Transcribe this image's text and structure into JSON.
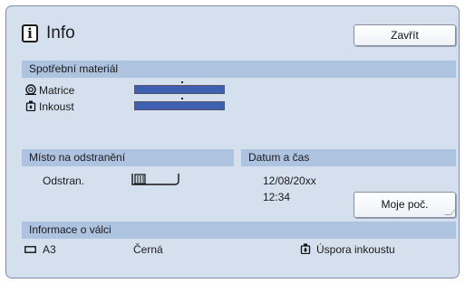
{
  "header": {
    "title": "Info",
    "title_icon": "info-icon",
    "close_label": "Zavřít"
  },
  "consumables": {
    "header": "Spotřební materiál",
    "items": [
      {
        "label": "Matrice",
        "icon": "master-roll-icon",
        "level": 1.0
      },
      {
        "label": "Inkoust",
        "icon": "ink-bottle-icon",
        "level": 1.0
      }
    ]
  },
  "disposal": {
    "header": "Místo na odstranění",
    "label": "Odstran.",
    "icon": "disposal-box-icon"
  },
  "datetime": {
    "header": "Datum a čas",
    "date": "12/08/20xx",
    "time": "12:34",
    "counter_label": "Moje poč."
  },
  "drum": {
    "header": "Informace o válci",
    "size": "A3",
    "size_icon": "paper-size-icon",
    "color": "Černá",
    "ink_mode": "Úspora inkoustu",
    "ink_mode_icon": "ink-saving-icon"
  },
  "colors": {
    "panel": "#d5e0ef",
    "section_header": "#aec3e0",
    "bar_fill": "#3f5fb3"
  }
}
